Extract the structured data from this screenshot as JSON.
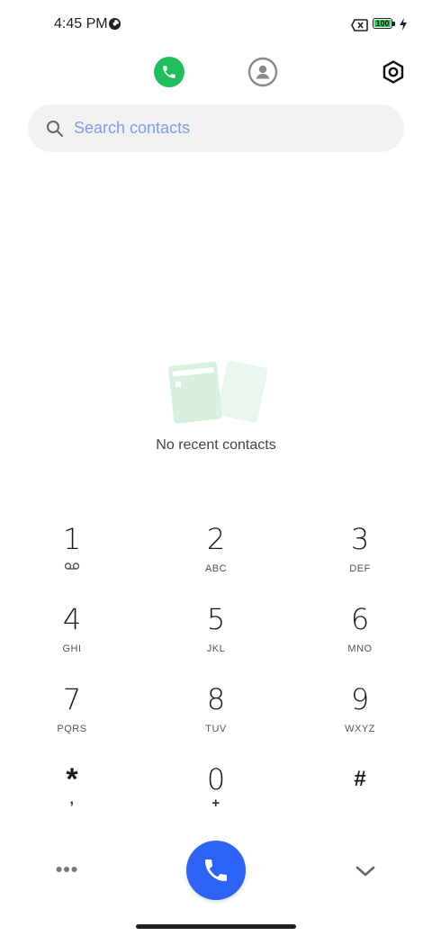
{
  "status_bar": {
    "time": "4:45 PM",
    "battery_level": "100",
    "battery_fill_fraction": 1.0,
    "battery_color": "#2bd05a",
    "icons": [
      "data-saver-icon",
      "no-sim-icon",
      "battery-icon",
      "charging-icon"
    ]
  },
  "nav": {
    "tabs": [
      {
        "name": "phone",
        "icon": "phone-icon",
        "active": true,
        "accent": "#1fbf5b"
      },
      {
        "name": "contacts",
        "icon": "person-icon",
        "active": false
      }
    ],
    "settings_icon": "gear-icon"
  },
  "search": {
    "placeholder": "Search contacts",
    "value": "",
    "icon": "search-icon"
  },
  "empty_state": {
    "message": "No recent contacts",
    "icon": "cards-illustration"
  },
  "keypad": {
    "keys": [
      {
        "digit": "1",
        "letters": "",
        "sub_icon": "voicemail-icon"
      },
      {
        "digit": "2",
        "letters": "ABC"
      },
      {
        "digit": "3",
        "letters": "DEF"
      },
      {
        "digit": "4",
        "letters": "GHI"
      },
      {
        "digit": "5",
        "letters": "JKL"
      },
      {
        "digit": "6",
        "letters": "MNO"
      },
      {
        "digit": "7",
        "letters": "PQRS"
      },
      {
        "digit": "8",
        "letters": "TUV"
      },
      {
        "digit": "9",
        "letters": "WXYZ"
      },
      {
        "digit": "*",
        "letters": ","
      },
      {
        "digit": "0",
        "letters": "+"
      },
      {
        "digit": "#",
        "letters": ""
      }
    ]
  },
  "bottom_bar": {
    "more_icon": "more-dots-icon",
    "call_icon": "phone-icon",
    "call_color": "#2d63f6",
    "collapse_icon": "chevron-down-icon"
  }
}
